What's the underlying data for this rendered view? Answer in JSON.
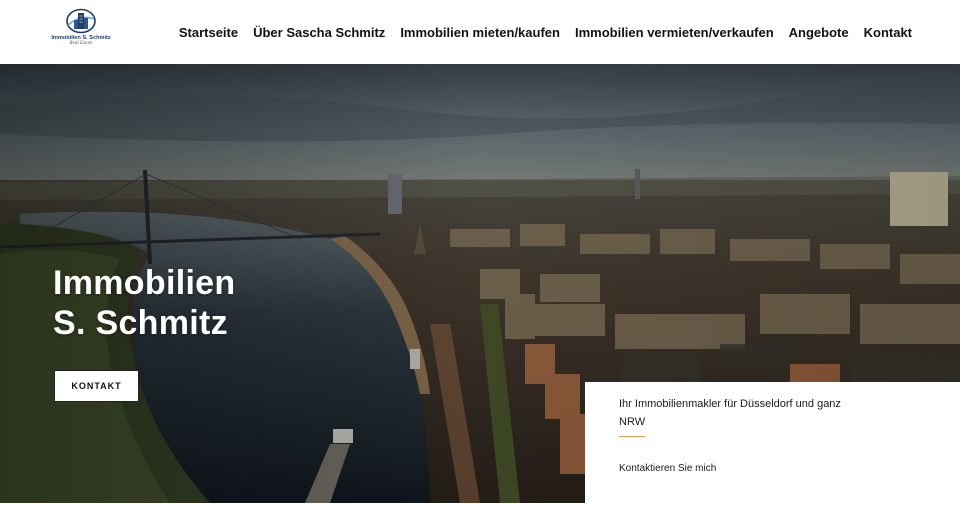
{
  "logo": {
    "name": "Immobilien S. Schmitz",
    "tagline": "Real Estate",
    "colors": {
      "primary": "#1f3d6b",
      "accent": "#6aa0d8"
    }
  },
  "nav": {
    "items": [
      {
        "label": "Startseite"
      },
      {
        "label": "Über Sascha Schmitz"
      },
      {
        "label": "Immobilien mieten/kaufen"
      },
      {
        "label": "Immobilien vermieten/verkaufen"
      },
      {
        "label": "Angebote"
      },
      {
        "label": "Kontakt"
      }
    ]
  },
  "hero": {
    "title_line1": "Immobilien",
    "title_line2": "S. Schmitz",
    "button_label": "KONTAKT",
    "background": "aerial-city-river-photo"
  },
  "info_card": {
    "text": "Ihr Immobilienmakler für Düsseldorf und ganz NRW",
    "link": "Kontaktieren Sie mich",
    "accent_color": "#e39b55"
  }
}
